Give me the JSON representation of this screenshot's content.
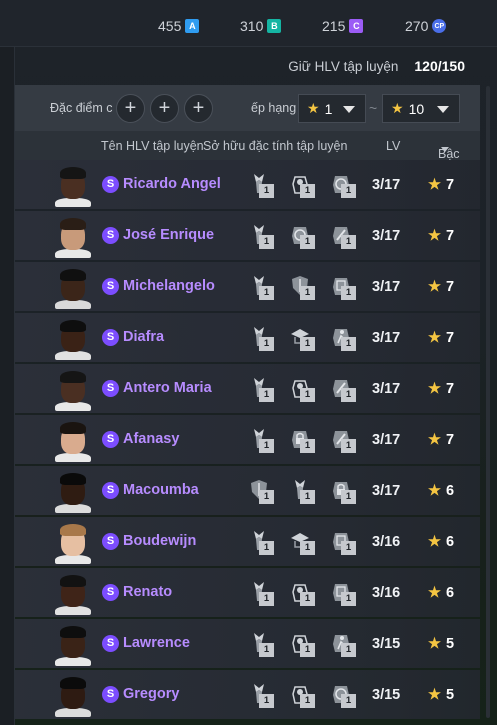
{
  "currencies": [
    {
      "value": "455",
      "icon": "A",
      "color": "#2f9cf0"
    },
    {
      "value": "310",
      "icon": "B",
      "color": "#15b5a3"
    },
    {
      "value": "215",
      "icon": "C",
      "color": "#9b5cf6"
    },
    {
      "value": "270",
      "icon": "CP",
      "color": "#4a6ee8"
    }
  ],
  "coach_count": {
    "label": "Giữ HLV tập luyện",
    "value": "120/150"
  },
  "filter": {
    "traits_label": "Đặc điểm c",
    "plus": "+",
    "rank_label": "ếp hạng",
    "rank_min": "1",
    "rank_max": "10",
    "separator": "~"
  },
  "columns": {
    "name": "Tên HLV tập luyện",
    "traits": "Sở hữu đặc tính tập luyện",
    "lv": "LV",
    "grade": "Bậc"
  },
  "colors": {
    "accent_purple": "#b78cff",
    "badge": "#7c4dff",
    "star": "#f4c542"
  },
  "rows": [
    {
      "badge": "S",
      "name": "Ricardo Angel",
      "traits": [
        {
          "icon": "defender-icon",
          "lvl": "1"
        },
        {
          "icon": "whistle-icon",
          "lvl": "1"
        },
        {
          "icon": "ball-icon",
          "lvl": "1"
        }
      ],
      "lv": "3/17",
      "grade": "7",
      "skin": "#4a2f22",
      "hair": "#151515",
      "shirt": "#e8e8e8"
    },
    {
      "badge": "S",
      "name": "José Enrique",
      "traits": [
        {
          "icon": "defender-icon",
          "lvl": "1"
        },
        {
          "icon": "ball-icon",
          "lvl": "1"
        },
        {
          "icon": "tackle-icon",
          "lvl": "1"
        }
      ],
      "lv": "3/17",
      "grade": "7",
      "skin": "#c89a7a",
      "hair": "#2a1e16",
      "shirt": "#e8e8e8"
    },
    {
      "badge": "S",
      "name": "Michelangelo",
      "traits": [
        {
          "icon": "defender-icon",
          "lvl": "1"
        },
        {
          "icon": "shield-icon",
          "lvl": "1"
        },
        {
          "icon": "goal-icon",
          "lvl": "1"
        }
      ],
      "lv": "3/17",
      "grade": "7",
      "skin": "#3b2519",
      "hair": "#101010",
      "shirt": "#d9d9d9"
    },
    {
      "badge": "S",
      "name": "Diafra",
      "traits": [
        {
          "icon": "defender-icon",
          "lvl": "1"
        },
        {
          "icon": "cap-icon",
          "lvl": "1"
        },
        {
          "icon": "runner-icon",
          "lvl": "1"
        }
      ],
      "lv": "3/17",
      "grade": "7",
      "skin": "#3a2216",
      "hair": "#0e0e0e",
      "shirt": "#e1e1e1"
    },
    {
      "badge": "S",
      "name": "Antero Maria",
      "traits": [
        {
          "icon": "defender-icon",
          "lvl": "1"
        },
        {
          "icon": "whistle-icon",
          "lvl": "1"
        },
        {
          "icon": "tackle-icon",
          "lvl": "1"
        }
      ],
      "lv": "3/17",
      "grade": "7",
      "skin": "#4a2f22",
      "hair": "#151515",
      "shirt": "#e8e8e8"
    },
    {
      "badge": "S",
      "name": "Afanasy",
      "traits": [
        {
          "icon": "defender-icon",
          "lvl": "1"
        },
        {
          "icon": "lock-icon",
          "lvl": "1"
        },
        {
          "icon": "tackle-icon",
          "lvl": "1"
        }
      ],
      "lv": "3/17",
      "grade": "7",
      "skin": "#d9ab8e",
      "hair": "#1a1410",
      "shirt": "#e8e8e8"
    },
    {
      "badge": "S",
      "name": "Macoumba",
      "traits": [
        {
          "icon": "shield-icon",
          "lvl": "1"
        },
        {
          "icon": "defender-icon",
          "lvl": "1"
        },
        {
          "icon": "lock-icon",
          "lvl": "1"
        }
      ],
      "lv": "3/17",
      "grade": "6",
      "skin": "#2f1c12",
      "hair": "#0a0a0a",
      "shirt": "#dcdcdc"
    },
    {
      "badge": "S",
      "name": "Boudewijn",
      "traits": [
        {
          "icon": "defender-icon",
          "lvl": "1"
        },
        {
          "icon": "cap-icon",
          "lvl": "1"
        },
        {
          "icon": "goal-icon",
          "lvl": "1"
        }
      ],
      "lv": "3/16",
      "grade": "6",
      "skin": "#e6bfa2",
      "hair": "#a8784a",
      "shirt": "#e8e8e8"
    },
    {
      "badge": "S",
      "name": "Renato",
      "traits": [
        {
          "icon": "defender-icon",
          "lvl": "1"
        },
        {
          "icon": "whistle-icon",
          "lvl": "1"
        },
        {
          "icon": "goal-icon",
          "lvl": "1"
        }
      ],
      "lv": "3/16",
      "grade": "6",
      "skin": "#3f2418",
      "hair": "#121212",
      "shirt": "#e1e1e1"
    },
    {
      "badge": "S",
      "name": "Lawrence",
      "traits": [
        {
          "icon": "defender-icon",
          "lvl": "1"
        },
        {
          "icon": "whistle-icon",
          "lvl": "1"
        },
        {
          "icon": "runner-icon",
          "lvl": "1"
        }
      ],
      "lv": "3/15",
      "grade": "5",
      "skin": "#3a2317",
      "hair": "#0e0e0e",
      "shirt": "#e8e8e8"
    },
    {
      "badge": "S",
      "name": "Gregory",
      "traits": [
        {
          "icon": "defender-icon",
          "lvl": "1"
        },
        {
          "icon": "whistle-icon",
          "lvl": "1"
        },
        {
          "icon": "ball-icon",
          "lvl": "1"
        }
      ],
      "lv": "3/15",
      "grade": "5",
      "skin": "#2e1b12",
      "hair": "#0b0b0b",
      "shirt": "#dcdcdc"
    }
  ]
}
